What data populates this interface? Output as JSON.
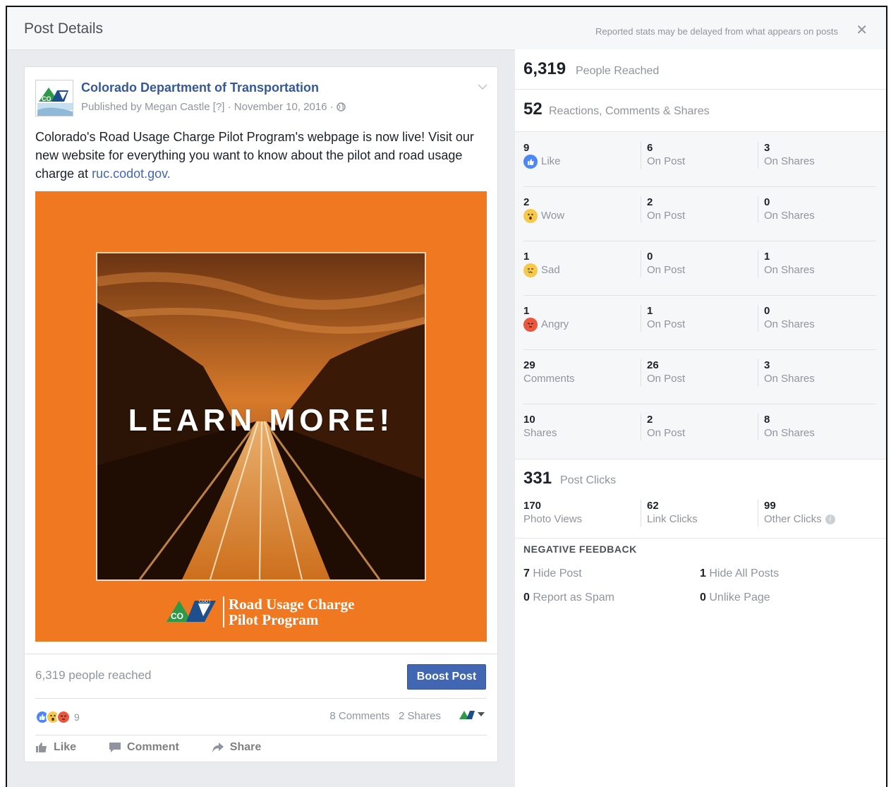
{
  "dialog": {
    "title": "Post Details",
    "note": "Reported stats may be delayed from what appears on posts",
    "close_glyph": "✕"
  },
  "post": {
    "page_name": "Colorado Department of Transportation",
    "byline": "Published by Megan Castle [?] · November 10, 2016 ·",
    "text_before_link": "Colorado's Road Usage Charge Pilot Program's webpage is now live! Visit our new website for everything you want to know about the pilot and road usage charge at ",
    "link": "ruc.codot.gov.",
    "image": {
      "headline": "LEARN MORE!",
      "logo_co": "CO",
      "logo_cdot": "CDOT",
      "logo_line1": "Road Usage Charge",
      "logo_line2": "Pilot Program",
      "background_color": "#f07821"
    },
    "reached": "6,319 people reached",
    "boost_label": "Boost Post",
    "reaction_count": "9",
    "comments": "8 Comments",
    "shares": "2 Shares",
    "actions": {
      "like": "Like",
      "comment": "Comment",
      "share": "Share"
    }
  },
  "stats": {
    "reached": {
      "value": "6,319",
      "label": "People Reached"
    },
    "engagement": {
      "value": "52",
      "label": "Reactions, Comments & Shares"
    },
    "breakdown": [
      {
        "value": "9",
        "label": "Like",
        "icon": "like-icon",
        "post": "6",
        "shares": "3"
      },
      {
        "value": "2",
        "label": "Wow",
        "icon": "wow-icon",
        "post": "2",
        "shares": "0"
      },
      {
        "value": "1",
        "label": "Sad",
        "icon": "sad-icon",
        "post": "0",
        "shares": "1"
      },
      {
        "value": "1",
        "label": "Angry",
        "icon": "angry-icon",
        "post": "1",
        "shares": "0"
      },
      {
        "value": "29",
        "label": "Comments",
        "icon": "",
        "post": "26",
        "shares": "3"
      },
      {
        "value": "10",
        "label": "Shares",
        "icon": "",
        "post": "2",
        "shares": "8"
      }
    ],
    "on_post": "On Post",
    "on_shares": "On Shares",
    "clicks": {
      "value": "331",
      "label": "Post Clicks",
      "photo_views": "170",
      "photo_views_label": "Photo Views",
      "link_clicks": "62",
      "link_clicks_label": "Link Clicks",
      "other_clicks": "99",
      "other_clicks_label": "Other Clicks"
    },
    "negative": {
      "heading": "NEGATIVE FEEDBACK",
      "hide_post": "7",
      "hide_post_label": "Hide Post",
      "hide_all": "1",
      "hide_all_label": "Hide All Posts",
      "spam": "0",
      "spam_label": "Report as Spam",
      "unlike": "0",
      "unlike_label": "Unlike Page"
    }
  },
  "colors": {
    "link": "#365899",
    "button": "#4267b2",
    "muted": "#90949c",
    "like": "#4e87f4",
    "angry": "#e9573f",
    "wow": "#f7c94a"
  }
}
